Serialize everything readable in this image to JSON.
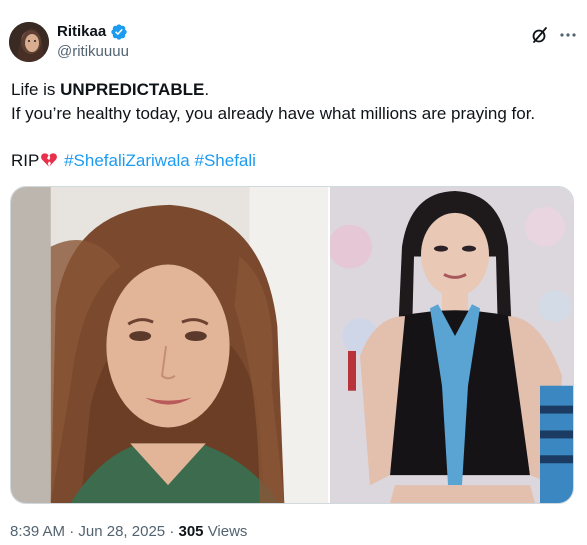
{
  "author": {
    "display_name": "Ritikaa",
    "handle": "@ritikuuuu",
    "verified": true
  },
  "header_icons": [
    "grok-icon",
    "more-icon"
  ],
  "tweet": {
    "line1_prefix": "Life is ",
    "line1_bold": "UNPREDICTABLE",
    "line1_suffix": ".",
    "line2": "If you’re healthy today, you already have what millions are praying for.",
    "line3_prefix": "RIP",
    "line3_icon": "broken-heart-icon",
    "hashtags": [
      "#ShefaliZariwala",
      "#Shefali"
    ]
  },
  "media": {
    "photos": [
      "photo-portrait-selfie",
      "photo-portrait-styled"
    ]
  },
  "meta": {
    "time": "8:39 AM",
    "separator": "·",
    "date": "Jun 28, 2025",
    "views_count": "305",
    "views_label": "Views"
  },
  "colors": {
    "text": "#0f1419",
    "secondary": "#536471",
    "accent": "#1d9bf0",
    "heart": "#f91880",
    "border": "#cfd9de"
  }
}
